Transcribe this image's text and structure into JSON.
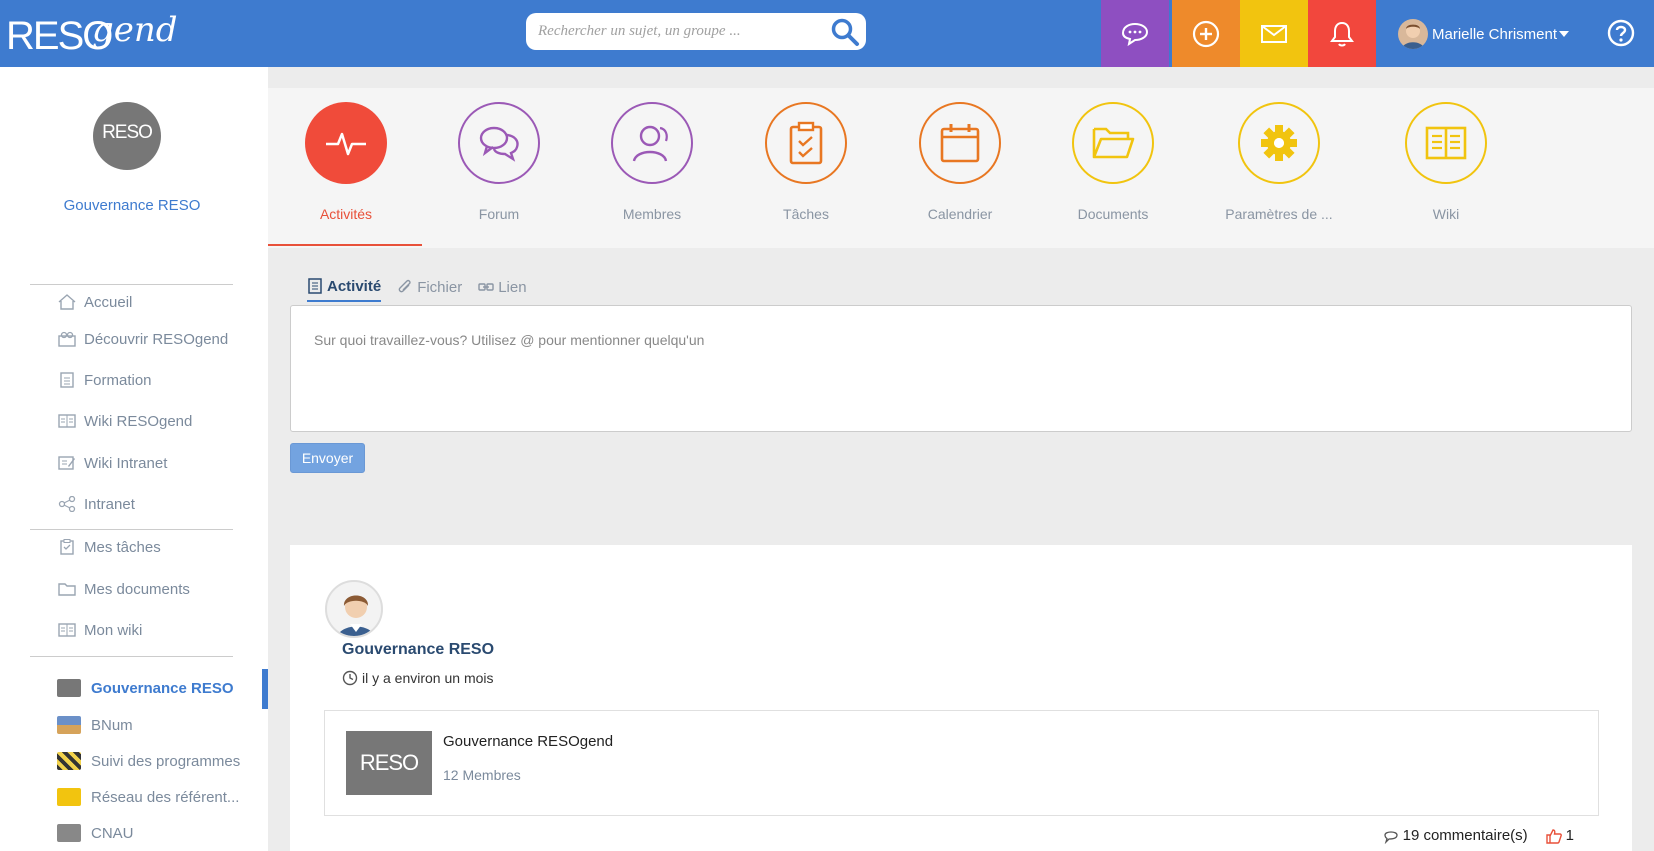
{
  "header": {
    "logo_main": "RESO",
    "logo_script": "gend",
    "search_placeholder": "Rechercher un sujet, un groupe ...",
    "user_name": "Marielle Chrisment",
    "colors": {
      "bar": "#3e7bcf",
      "chat": "#8e4fc1",
      "add": "#ee8a2b",
      "mail": "#f2c40f",
      "notif": "#f2473d"
    }
  },
  "sidebar": {
    "group_logo_text": "RESO",
    "group_title": "Gouvernance RESO",
    "nav": [
      {
        "label": "Accueil",
        "icon": "home-icon"
      },
      {
        "label": "Découvrir RESOgend",
        "icon": "discover-icon"
      },
      {
        "label": "Formation",
        "icon": "document-icon"
      },
      {
        "label": "Wiki RESOgend",
        "icon": "book-icon"
      },
      {
        "label": "Wiki Intranet",
        "icon": "edit-book-icon"
      },
      {
        "label": "Intranet",
        "icon": "share-icon"
      },
      {
        "label": "Mes tâches",
        "icon": "clipboard-icon"
      },
      {
        "label": "Mes documents",
        "icon": "folder-icon"
      },
      {
        "label": "Mon wiki",
        "icon": "book-icon"
      }
    ],
    "groups": [
      {
        "label": "Gouvernance RESO"
      },
      {
        "label": "BNum"
      },
      {
        "label": "Suivi des programmes"
      },
      {
        "label": "Réseau des référent..."
      },
      {
        "label": "CNAU"
      }
    ]
  },
  "apps": [
    {
      "label": "Activités",
      "color": "#f04b3a"
    },
    {
      "label": "Forum",
      "color": "#9b59b6"
    },
    {
      "label": "Membres",
      "color": "#9b59b6"
    },
    {
      "label": "Tâches",
      "color": "#e87722"
    },
    {
      "label": "Calendrier",
      "color": "#e87722"
    },
    {
      "label": "Documents",
      "color": "#f1c40f"
    },
    {
      "label": "Paramètres de ...",
      "color": "#f1c40f"
    },
    {
      "label": "Wiki",
      "color": "#f1c40f"
    }
  ],
  "composer": {
    "tabs": [
      "Activité",
      "Fichier",
      "Lien"
    ],
    "placeholder": "Sur quoi travaillez-vous? Utilisez @ pour mentionner quelqu'un",
    "send_label": "Envoyer"
  },
  "activity": {
    "author": "Gouvernance RESO",
    "time": "il y a environ un mois",
    "embed_logo_text": "RESO",
    "embed_title": "Gouvernance RESOgend",
    "embed_sub": "12 Membres",
    "comments": "19 commentaire(s)",
    "likes": "1"
  }
}
